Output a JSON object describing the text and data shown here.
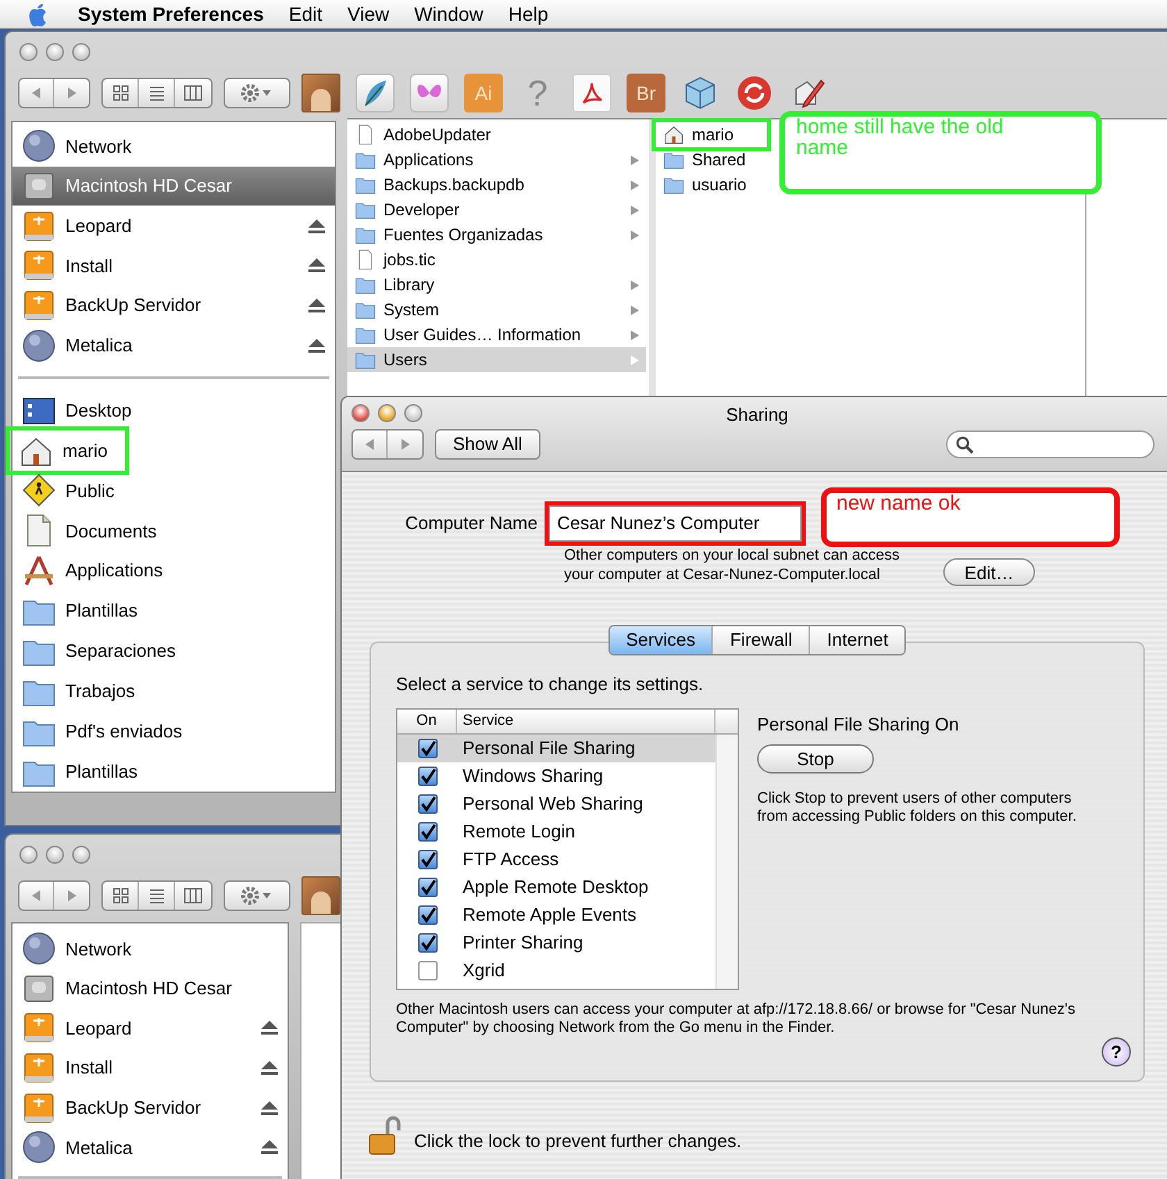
{
  "menu_bar": {
    "app_name": "System Preferences",
    "menus": [
      "Edit",
      "View",
      "Window",
      "Help"
    ]
  },
  "finder_window": {
    "toolbar_icons": [
      {
        "kind": "painting"
      },
      {
        "kind": "feather"
      },
      {
        "kind": "butterfly"
      },
      {
        "kind": "tile",
        "label": "Ai",
        "color": "#e8923a"
      },
      {
        "kind": "glyph",
        "label": "?"
      },
      {
        "kind": "acrobat"
      },
      {
        "kind": "tile",
        "label": "Br",
        "color": "#b8683a"
      },
      {
        "kind": "cube"
      },
      {
        "kind": "sync"
      },
      {
        "kind": "pencil"
      }
    ],
    "sidebar": {
      "devices": [
        {
          "label": "Network",
          "kind": "network",
          "ejectable": false,
          "selected": false
        },
        {
          "label": "Macintosh HD Cesar",
          "kind": "disk",
          "ejectable": false,
          "selected": true
        },
        {
          "label": "Leopard",
          "kind": "firewire",
          "ejectable": true,
          "selected": false
        },
        {
          "label": "Install",
          "kind": "firewire",
          "ejectable": true,
          "selected": false
        },
        {
          "label": "BackUp Servidor",
          "kind": "firewire",
          "ejectable": true,
          "selected": false
        },
        {
          "label": "Metalica",
          "kind": "network",
          "ejectable": true,
          "selected": false
        }
      ],
      "places": [
        {
          "label": "Desktop",
          "kind": "desktop",
          "outlined": false
        },
        {
          "label": "mario",
          "kind": "home",
          "outlined": true
        },
        {
          "label": "Public",
          "kind": "public",
          "outlined": false
        },
        {
          "label": "Documents",
          "kind": "documents",
          "outlined": false
        },
        {
          "label": "Applications",
          "kind": "applications",
          "outlined": false
        },
        {
          "label": "Plantillas",
          "kind": "folder",
          "outlined": false
        },
        {
          "label": "Separaciones",
          "kind": "folder",
          "outlined": false
        },
        {
          "label": "Trabajos",
          "kind": "folder",
          "outlined": false
        },
        {
          "label": "Pdf's enviados",
          "kind": "folder",
          "outlined": false
        },
        {
          "label": "Plantillas",
          "kind": "folder",
          "outlined": false
        }
      ]
    },
    "columns": [
      {
        "items": [
          {
            "label": "AdobeUpdater",
            "kind": "file",
            "has_children": false,
            "selected": false
          },
          {
            "label": "Applications",
            "kind": "folder",
            "has_children": true,
            "selected": false
          },
          {
            "label": "Backups.backupdb",
            "kind": "folder",
            "has_children": true,
            "selected": false
          },
          {
            "label": "Developer",
            "kind": "folder",
            "has_children": true,
            "selected": false
          },
          {
            "label": "Fuentes Organizadas",
            "kind": "folder",
            "has_children": true,
            "selected": false
          },
          {
            "label": "jobs.tic",
            "kind": "file",
            "has_children": false,
            "selected": false
          },
          {
            "label": "Library",
            "kind": "folder",
            "has_children": true,
            "selected": false
          },
          {
            "label": "System",
            "kind": "folder",
            "has_children": true,
            "selected": false
          },
          {
            "label": "User Guides… Information",
            "kind": "folder",
            "has_children": true,
            "selected": false
          },
          {
            "label": "Users",
            "kind": "folder",
            "has_children": true,
            "selected": true
          }
        ]
      },
      {
        "items": [
          {
            "label": "mario",
            "kind": "home",
            "has_children": false,
            "selected": false,
            "outlined": true
          },
          {
            "label": "Shared",
            "kind": "folder",
            "has_children": false,
            "selected": false,
            "outlined": false
          },
          {
            "label": "usuario",
            "kind": "folder",
            "has_children": false,
            "selected": false,
            "outlined": false
          }
        ]
      }
    ]
  },
  "second_finder_window": {
    "sidebar": {
      "devices": [
        {
          "label": "Network",
          "kind": "network",
          "ejectable": false
        },
        {
          "label": "Macintosh HD Cesar",
          "kind": "disk",
          "ejectable": false
        },
        {
          "label": "Leopard",
          "kind": "firewire",
          "ejectable": true
        },
        {
          "label": "Install",
          "kind": "firewire",
          "ejectable": true
        },
        {
          "label": "BackUp Servidor",
          "kind": "firewire",
          "ejectable": true
        },
        {
          "label": "Metalica",
          "kind": "network",
          "ejectable": true
        }
      ]
    }
  },
  "sharing_window": {
    "title": "Sharing",
    "show_all": "Show All",
    "computer_name_label": "Computer Name",
    "computer_name": "Cesar Nunez’s Computer",
    "computer_name_outlined": true,
    "subnet_note": "Other computers on your local subnet can access your computer at Cesar-Nunez-Computer.local",
    "edit_button": "Edit…",
    "tabs": [
      {
        "label": "Services",
        "selected": true
      },
      {
        "label": "Firewall",
        "selected": false
      },
      {
        "label": "Internet",
        "selected": false
      }
    ],
    "instruction": "Select a service to change its settings.",
    "table_columns": [
      "On",
      "Service"
    ],
    "services": [
      {
        "label": "Personal File Sharing",
        "checked": true,
        "selected": true
      },
      {
        "label": "Windows Sharing",
        "checked": true,
        "selected": false
      },
      {
        "label": "Personal Web Sharing",
        "checked": true,
        "selected": false
      },
      {
        "label": "Remote Login",
        "checked": true,
        "selected": false
      },
      {
        "label": "FTP Access",
        "checked": true,
        "selected": false
      },
      {
        "label": "Apple Remote Desktop",
        "checked": true,
        "selected": false
      },
      {
        "label": "Remote Apple Events",
        "checked": true,
        "selected": false
      },
      {
        "label": "Printer Sharing",
        "checked": true,
        "selected": false
      },
      {
        "label": "Xgrid",
        "checked": false,
        "selected": false
      }
    ],
    "detail_title": "Personal File Sharing On",
    "stop_button": "Stop",
    "detail_text": "Click Stop to prevent users of other computers from accessing Public folders on this computer.",
    "footer_note": "Other Macintosh users can access your computer at afp://172.18.8.66/ or browse for \"Cesar Nunez's Computer\" by choosing Network from the Go menu in the Finder.",
    "help_button": "?",
    "lock_text": "Click the lock to prevent further changes."
  },
  "annotations": [
    {
      "text": "home still have the old name",
      "color": "#33ee33"
    },
    {
      "text": "new name ok",
      "color": "#ee1111"
    }
  ]
}
